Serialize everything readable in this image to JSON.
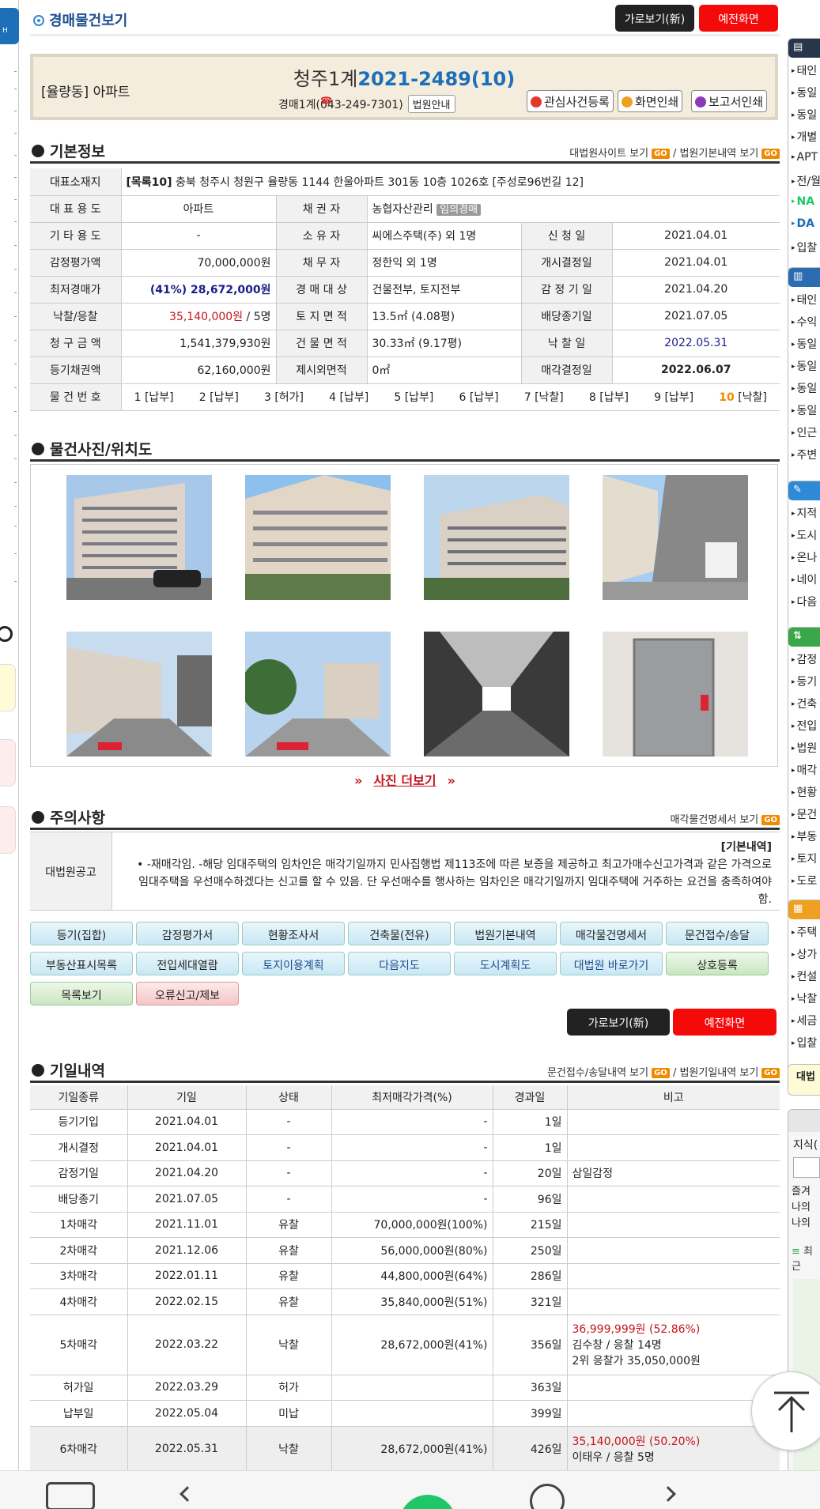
{
  "header": {
    "title": "경매물건보기",
    "btn_new": "가로보기(新)",
    "btn_old": "예전화면"
  },
  "case": {
    "type": "[율량동] 아파트",
    "court_prefix": "청주1계",
    "case_no": "2021-2489(10)",
    "dept": "경매1계(",
    "phone": "043-249-7301)",
    "court_info": "법원안내",
    "btn_interest": "관심사건등록",
    "btn_print": "화면인쇄",
    "btn_report": "보고서인쇄"
  },
  "basic": {
    "title": "기본정보",
    "link1": "대법원사이트 보기",
    "link2": "법원기본내역 보기",
    "go": "GO",
    "address_label": "대표소재지",
    "address_prefix": "[목록10]",
    "address": " 충북 청주시 청원구 율량동 1144 한울아파트 301동 10층 1026호 [주성로96번길 12]",
    "rows": [
      [
        "대 표 용 도",
        "아파트",
        "채 권 자",
        "농협자산관리",
        "임의경매",
        "",
        ""
      ],
      [
        "기 타 용 도",
        "-",
        "소 유 자",
        "씨에스주택(주) 외 1명",
        "",
        "신 청 일",
        "2021.04.01"
      ],
      [
        "감정평가액",
        "70,000,000원",
        "채 무 자",
        "정한익 외 1명",
        "",
        "개시결정일",
        "2021.04.01"
      ],
      [
        "최저경매가",
        "(41%) 28,672,000원",
        "경 매 대 상",
        "건물전부, 토지전부",
        "",
        "감 정 기 일",
        "2021.04.20"
      ],
      [
        "낙찰/응찰",
        "35,140,000원",
        "토 지 면 적",
        "13.5㎡ (4.08평)",
        "",
        "배당종기일",
        "2021.07.05"
      ],
      [
        "청 구 금 액",
        "1,541,379,930원",
        "건 물 면 적",
        "30.33㎡ (9.17평)",
        "",
        "낙 찰 일",
        "2022.05.31"
      ],
      [
        "등기채권액",
        "62,160,000원",
        "제시외면적",
        "0㎡",
        "",
        "매각결정일",
        "2022.06.07"
      ]
    ],
    "bid_suffix": " / 5명",
    "items_label": "물 건 번 호",
    "items": [
      [
        "1",
        "[납부]"
      ],
      [
        "2",
        "[납부]"
      ],
      [
        "3",
        "[허가]"
      ],
      [
        "4",
        "[납부]"
      ],
      [
        "5",
        "[납부]"
      ],
      [
        "6",
        "[납부]"
      ],
      [
        "7",
        "[낙찰]"
      ],
      [
        "8",
        "[납부]"
      ],
      [
        "9",
        "[납부]"
      ],
      [
        "10",
        "[낙찰]"
      ]
    ]
  },
  "photos": {
    "title": "물건사진/위치도",
    "more": "사진 더보기"
  },
  "notice": {
    "title": "주의사항",
    "link": "매각물건명세서 보기",
    "label": "대법원공고",
    "head": "[기본내역]",
    "body": "-재매각임. -해당 임대주택의 임차인은 매각기일까지 민사집행법 제113조에 따른 보증을 제공하고 최고가매수신고가격과 같은 가격으로 임대주택을 우선매수하겠다는 신고를 할 수 있음. 단 우선매수를 행사하는 임차인은 매각기일까지 임대주택에 거주하는 요건을 충족하여야 함."
  },
  "links": [
    "등기(집합)",
    "감정평가서",
    "현황조사서",
    "건축물(전유)",
    "법원기본내역",
    "매각물건명세서",
    "문건접수/송달",
    "부동산표시목록",
    "전입세대열람",
    "토지이용계획",
    "다음지도",
    "도시계획도",
    "대법원 바로가기",
    "상호등록",
    "목록보기",
    "오류신고/제보"
  ],
  "history": {
    "title": "기일내역",
    "link1": "문건접수/송달내역 보기",
    "link2": "법원기일내역 보기",
    "cols": [
      "기일종류",
      "기일",
      "상태",
      "최저매각가격(%)",
      "경과일",
      "비고"
    ],
    "rows": [
      [
        "등기기입",
        "2021.04.01",
        "-",
        "-",
        "1일",
        ""
      ],
      [
        "개시결정",
        "2021.04.01",
        "-",
        "-",
        "1일",
        ""
      ],
      [
        "감정기일",
        "2021.04.20",
        "-",
        "-",
        "20일",
        "삼일감정"
      ],
      [
        "배당종기",
        "2021.07.05",
        "-",
        "-",
        "96일",
        ""
      ],
      [
        "1차매각",
        "2021.11.01",
        "유찰",
        "70,000,000원(100%)",
        "215일",
        ""
      ],
      [
        "2차매각",
        "2021.12.06",
        "유찰",
        "56,000,000원(80%)",
        "250일",
        ""
      ],
      [
        "3차매각",
        "2022.01.11",
        "유찰",
        "44,800,000원(64%)",
        "286일",
        ""
      ],
      [
        "4차매각",
        "2022.02.15",
        "유찰",
        "35,840,000원(51%)",
        "321일",
        ""
      ],
      [
        "5차매각",
        "2022.03.22",
        "낙찰",
        "28,672,000원(41%)",
        "356일",
        ""
      ],
      [
        "허가일",
        "2022.03.29",
        "허가",
        "",
        "363일",
        ""
      ],
      [
        "납부일",
        "2022.05.04",
        "미납",
        "",
        "399일",
        ""
      ],
      [
        "6차매각",
        "2022.05.31",
        "낙찰",
        "28,672,000원(41%)",
        "426일",
        ""
      ]
    ],
    "r5_price": "36,999,999원 (52.86%)",
    "r5_winner": "김수창 / 응찰 14명",
    "r5_second": "2위 응찰가 35,050,000원",
    "r6_price": "35,140,000원 (50.20%)",
    "r6_winner": "이태우 / 응찰 5명"
  },
  "right": {
    "box1": [
      "태인",
      "동일",
      "동일",
      "개별",
      "APT",
      "전/월",
      "NA",
      "DA",
      "입찰"
    ],
    "box2": [
      "태인",
      "수익",
      "동일",
      "동일",
      "동일",
      "동일",
      "인근",
      "주변"
    ],
    "box3": [
      "지적",
      "도시",
      "온나",
      "네이",
      "다음"
    ],
    "box4": [
      "감정",
      "등기",
      "건축",
      "전입",
      "법원",
      "매각",
      "현황",
      "문건",
      "부동",
      "토지",
      "도로"
    ],
    "box5": [
      "주택",
      "상가",
      "컨설",
      "낙찰",
      "세금",
      "입찰"
    ],
    "side1": "대법",
    "side2": "지식(",
    "side3": [
      "즐겨",
      "나의",
      "나의"
    ],
    "side4": "최근"
  }
}
